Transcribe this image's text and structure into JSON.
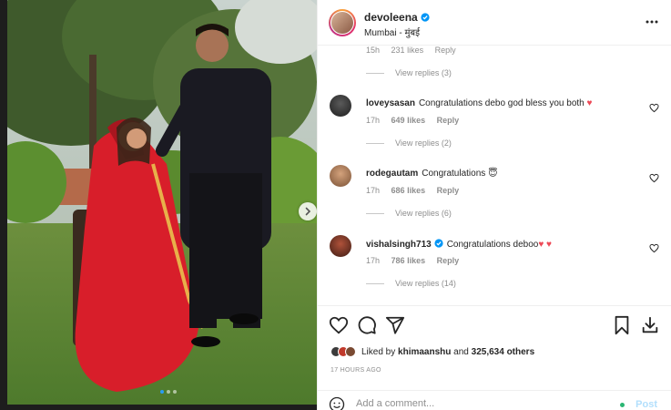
{
  "post": {
    "username": "devoleena",
    "location": "Mumbai - मुंबई",
    "carousel": {
      "total": 3,
      "active": 1
    }
  },
  "top_partial": {
    "time": "15h",
    "likes": "231 likes",
    "reply": "Reply",
    "view_replies": "View replies (3)"
  },
  "comments": [
    {
      "username": "loveysasan",
      "verified": false,
      "text": "Congratulations debo god bless you both",
      "emoji": "♥",
      "time": "17h",
      "likes": "649 likes",
      "reply": "Reply",
      "view_replies": "View replies (2)"
    },
    {
      "username": "rodegautam",
      "verified": false,
      "text": "Congratulations",
      "emoji": "😇",
      "time": "17h",
      "likes": "686 likes",
      "reply": "Reply",
      "view_replies": "View replies (6)"
    },
    {
      "username": "vishalsingh713",
      "verified": true,
      "text": "Congratulations deboo",
      "emoji": "♥ ♥",
      "time": "17h",
      "likes": "786 likes",
      "reply": "Reply",
      "view_replies": "View replies (14)"
    }
  ],
  "likes": {
    "prefix": "Liked by",
    "user": "khimaanshu",
    "and": "and",
    "count": "325,634 others"
  },
  "time_ago": "17 HOURS AGO",
  "comment_box": {
    "placeholder": "Add a comment...",
    "post_label": "Post"
  },
  "colors": {
    "verified": "#0095f6",
    "heart": "#ed4956",
    "link": "#b2dffc"
  },
  "icons": [
    "heart-icon",
    "comment-icon",
    "share-icon",
    "bookmark-icon",
    "download-icon",
    "more-icon",
    "emoji-icon",
    "chevron-right-icon"
  ]
}
